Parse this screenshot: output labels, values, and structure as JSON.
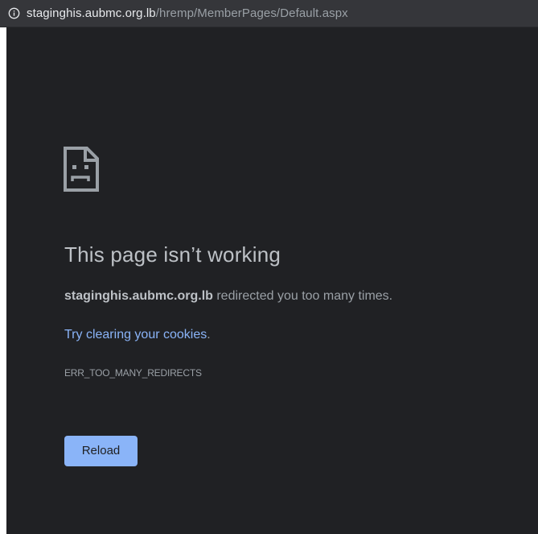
{
  "url_bar": {
    "icon": "info-icon",
    "host": "staginghis.aubmc.org.lb",
    "path": "/hremp/MemberPages/Default.aspx"
  },
  "error_page": {
    "icon": "sad-page-icon",
    "heading": "This page isn’t working",
    "host": "staginghis.aubmc.org.lb",
    "summary_rest": " redirected you too many times.",
    "suggestion_link": "Try clearing your cookies",
    "suggestion_end": ".",
    "error_code": "ERR_TOO_MANY_REDIRECTS",
    "reload_label": "Reload"
  },
  "colors": {
    "page_background": "#202124",
    "url_bar_background": "#35363a",
    "heading_text": "#bdc1c6",
    "body_text": "#9aa0a6",
    "link": "#8ab4f8",
    "button_background": "#8ab4f8"
  }
}
